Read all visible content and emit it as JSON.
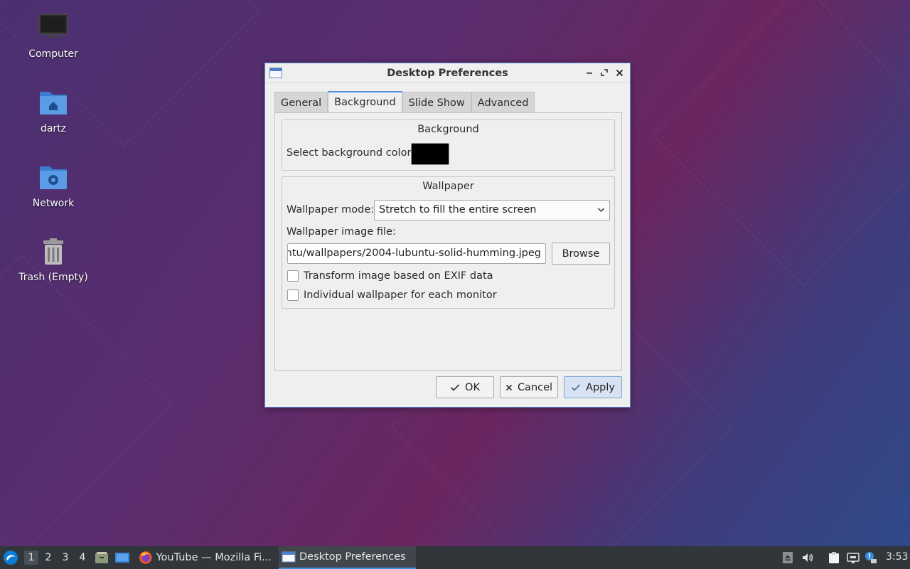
{
  "desktop": {
    "icons": [
      {
        "label": "Computer"
      },
      {
        "label": "dartz"
      },
      {
        "label": "Network"
      },
      {
        "label": "Trash (Empty)"
      }
    ]
  },
  "dialog": {
    "title": "Desktop Preferences",
    "tabs": [
      {
        "label": "General"
      },
      {
        "label": "Background"
      },
      {
        "label": "Slide Show"
      },
      {
        "label": "Advanced"
      }
    ],
    "active_tab": "Background",
    "background_group": {
      "title": "Background",
      "color_label": "Select background color:",
      "color_value": "#000000"
    },
    "wallpaper_group": {
      "title": "Wallpaper",
      "mode_label": "Wallpaper mode:",
      "mode_value": "Stretch to fill the entire screen",
      "file_label": "Wallpaper image file:",
      "file_value": "›untu/wallpapers/2004-lubuntu-solid-humming.jpeg",
      "browse_label": "Browse",
      "exif_label": "Transform image based on EXIF data",
      "exif_checked": false,
      "monitor_label": "Individual wallpaper for each monitor",
      "monitor_checked": false
    },
    "buttons": {
      "ok": "OK",
      "cancel": "Cancel",
      "apply": "Apply"
    }
  },
  "taskbar": {
    "workspaces": [
      "1",
      "2",
      "3",
      "4"
    ],
    "active_workspace": "1",
    "tasks": [
      {
        "label": "YouTube — Mozilla Fi...",
        "icon": "firefox-icon"
      },
      {
        "label": "Desktop Preferences",
        "icon": "window-icon"
      }
    ],
    "clock": "3:53"
  },
  "colors": {
    "accent": "#3b8de0",
    "taskbar": "#31363b",
    "dialog_bg": "#efefef"
  }
}
